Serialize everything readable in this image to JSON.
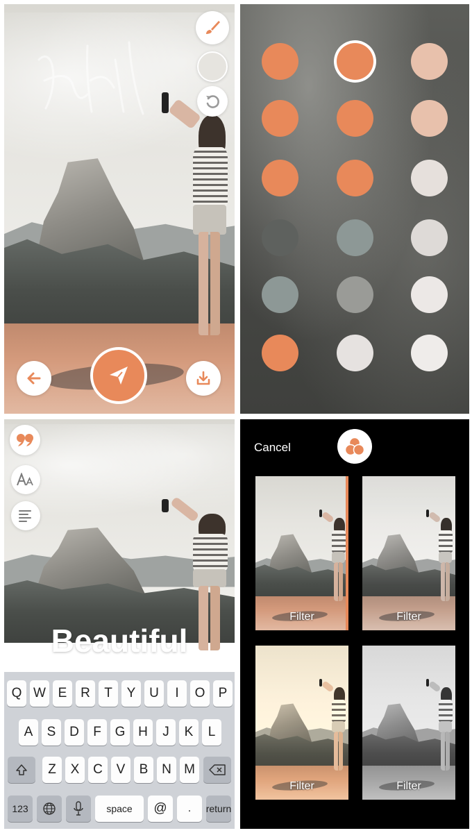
{
  "colors": {
    "accent": "#e8895a",
    "white": "#ffffff",
    "keyboard_bg": "#cfd2d7",
    "filter_screen_bg": "#000000"
  },
  "draw_screen": {
    "toolbar": [
      {
        "name": "brush-button",
        "icon": "brush-icon"
      },
      {
        "name": "color-button",
        "icon": "empty-circle"
      },
      {
        "name": "undo-button",
        "icon": "undo-icon"
      }
    ],
    "bottom_bar": {
      "back_icon": "arrow-left-icon",
      "send_icon": "send-icon",
      "save_icon": "download-icon"
    }
  },
  "color_picker": {
    "selected_index": 1,
    "swatches": [
      "#e8895a",
      "#e8895a",
      "#e8c1ac",
      "#e8895a",
      "#e8895a",
      "#e8c1ac",
      "#e8895a",
      "#e8895a",
      "#e6e0dc",
      "#5e615e",
      "#8d9896",
      "#dedad7",
      "#8d9896",
      "#9a9b97",
      "#ece8e6",
      "#e8895a",
      "#e6e2e0",
      "#efecea"
    ]
  },
  "text_screen": {
    "tools": [
      {
        "name": "quote-button",
        "icon": "quote-icon"
      },
      {
        "name": "font-size-button",
        "icon": "font-size-icon"
      },
      {
        "name": "align-button",
        "icon": "align-left-icon"
      }
    ],
    "caption": "Beautiful",
    "keyboard": {
      "row1": [
        "Q",
        "W",
        "E",
        "R",
        "T",
        "Y",
        "U",
        "I",
        "O",
        "P"
      ],
      "row2": [
        "A",
        "S",
        "D",
        "F",
        "G",
        "H",
        "J",
        "K",
        "L"
      ],
      "row3": [
        "Z",
        "X",
        "C",
        "V",
        "B",
        "N",
        "M"
      ],
      "shift_icon": "shift-icon",
      "delete_icon": "backspace-icon",
      "numbers_label": "123",
      "globe_icon": "globe-icon",
      "mic_icon": "microphone-icon",
      "space_label": "space",
      "at_label": "@",
      "dot_label": ".",
      "return_label": "return"
    }
  },
  "filter_screen": {
    "cancel_label": "Cancel",
    "filters_icon": "filters-icon",
    "thumbnails": [
      {
        "label": "Filter"
      },
      {
        "label": "Filter"
      },
      {
        "label": "Filter"
      },
      {
        "label": "Filter"
      }
    ]
  }
}
